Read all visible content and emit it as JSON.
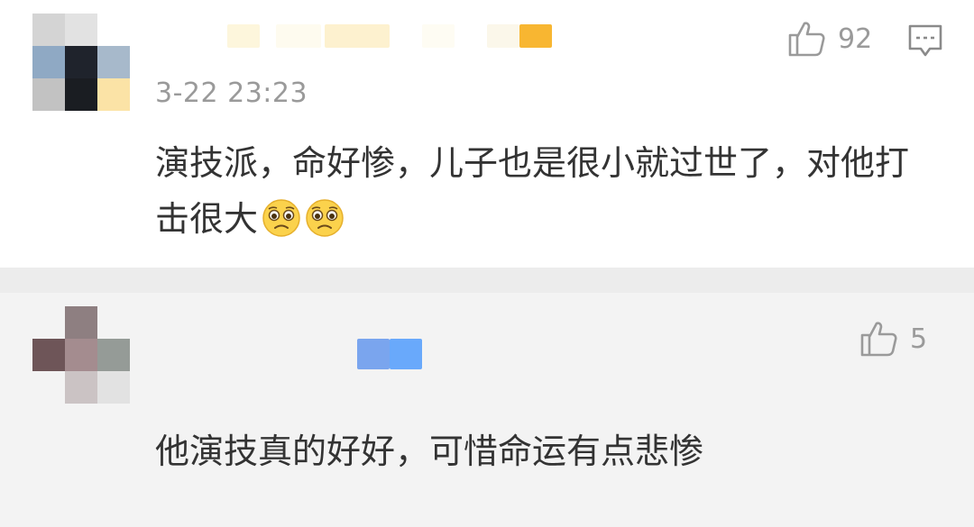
{
  "comments": [
    {
      "time": "3-22 23:23",
      "likes": "92",
      "text": "演技派，命好惨，儿子也是很小就过世了，对他打击很大",
      "emojis": [
        "pleading-face-emoji",
        "pleading-face-emoji"
      ],
      "name_blur_colors": [
        "#fdf6dc",
        "#fefbef",
        "#fdf1cf",
        "#fefcf3",
        "#fbf7ea",
        "#f8b631"
      ]
    },
    {
      "time": "",
      "likes": "5",
      "text": "他演技真的好好，可惜命运有点悲惨",
      "name_blur_colors": [
        "#7aa5ee",
        "#69a9fb"
      ]
    }
  ],
  "icons": {
    "like": "thumbs-up-icon",
    "reply": "comment-bubble-icon"
  },
  "colors": {
    "text": "#333333",
    "meta": "#9a9a9a",
    "background": "#ffffff",
    "separator": "#ececec"
  }
}
